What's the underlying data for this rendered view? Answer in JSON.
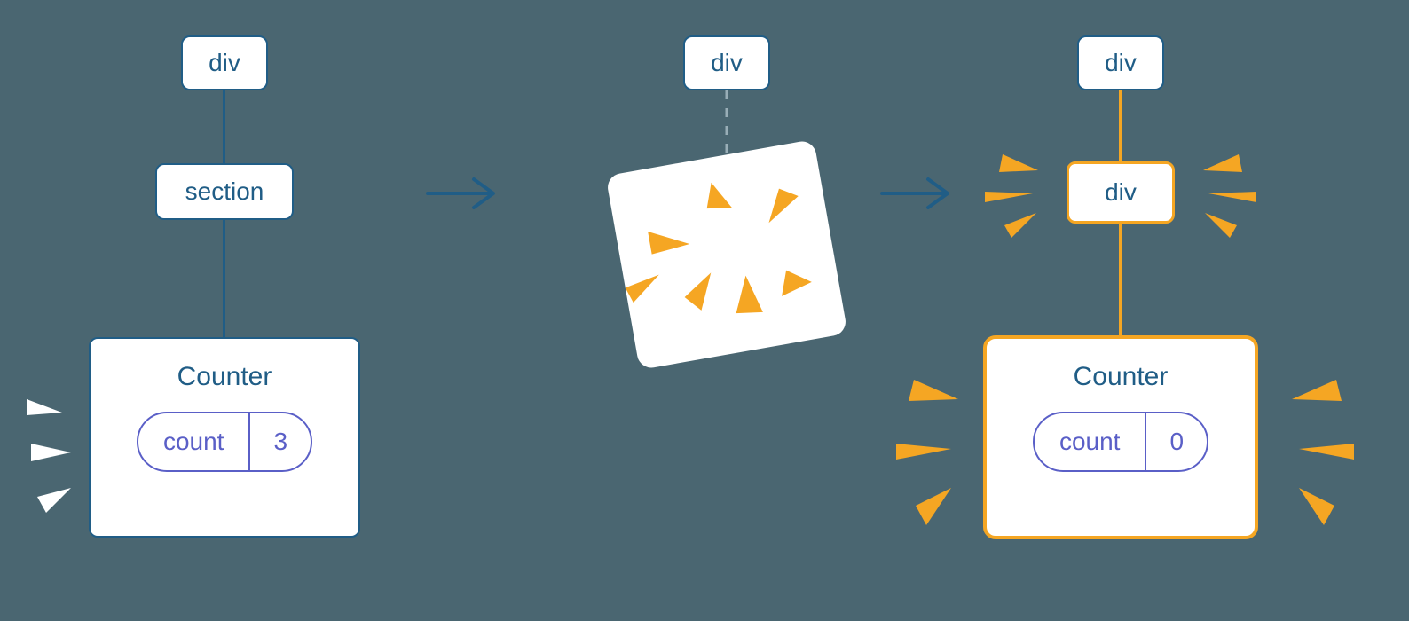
{
  "tree_left": {
    "root": "div",
    "mid": "section",
    "counter_title": "Counter",
    "pill_label": "count",
    "pill_value": "3"
  },
  "tree_middle": {
    "root": "div"
  },
  "tree_right": {
    "root": "div",
    "mid": "div",
    "counter_title": "Counter",
    "pill_label": "count",
    "pill_value": "0"
  },
  "colors": {
    "blue": "#205d86",
    "orange": "#f5a623",
    "purple": "#5a5fc7",
    "bg": "#4a6671"
  }
}
